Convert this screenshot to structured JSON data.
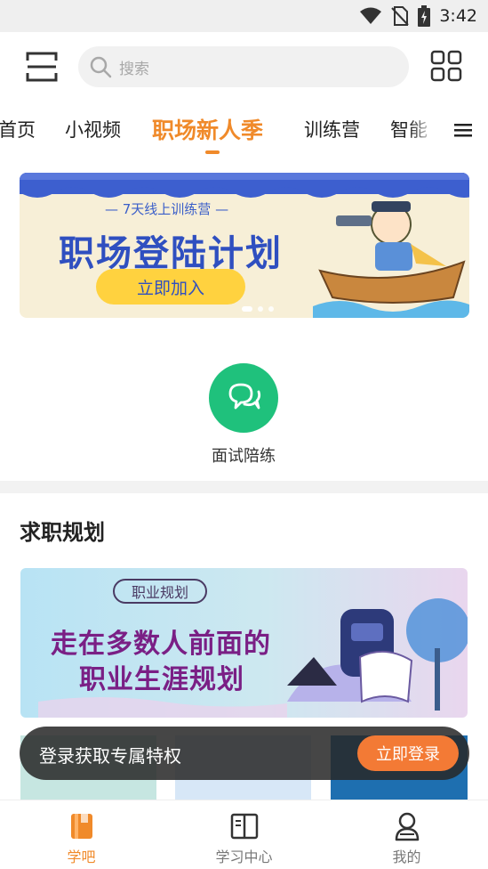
{
  "status_bar": {
    "time": "3:42",
    "icons": [
      "wifi-icon",
      "no-sim-icon",
      "battery-icon"
    ]
  },
  "header": {
    "scan_icon": "scan-icon",
    "search_placeholder": "搜索",
    "grid_icon": "apps-grid-icon"
  },
  "tabs": {
    "items": [
      {
        "label": "首页"
      },
      {
        "label": "小视频"
      },
      {
        "label": "职场新人季",
        "active": true
      },
      {
        "label": "训练营"
      },
      {
        "label": "智能"
      }
    ],
    "menu_icon": "hamburger-menu-icon"
  },
  "banner": {
    "subtitle": "— 7天线上训练营 —",
    "title": "职场登陆计划",
    "cta": "立即加入"
  },
  "feature": {
    "label": "面试陪练",
    "icon": "chat-bubbles-icon"
  },
  "section": {
    "title": "求职规划"
  },
  "career_banner": {
    "tag": "职业规划",
    "line1": "走在多数人前面的",
    "line2": "职业生涯规划"
  },
  "login_prompt": {
    "text": "登录获取专属特权",
    "button": "立即登录"
  },
  "bottom_nav": {
    "items": [
      {
        "label": "学吧",
        "icon": "book-icon",
        "active": true
      },
      {
        "label": "学习中心",
        "icon": "open-book-icon"
      },
      {
        "label": "我的",
        "icon": "profile-icon"
      }
    ]
  },
  "colors": {
    "accent": "#f08a2a",
    "feature_green": "#1fc17c",
    "login_button": "#f37a35"
  }
}
